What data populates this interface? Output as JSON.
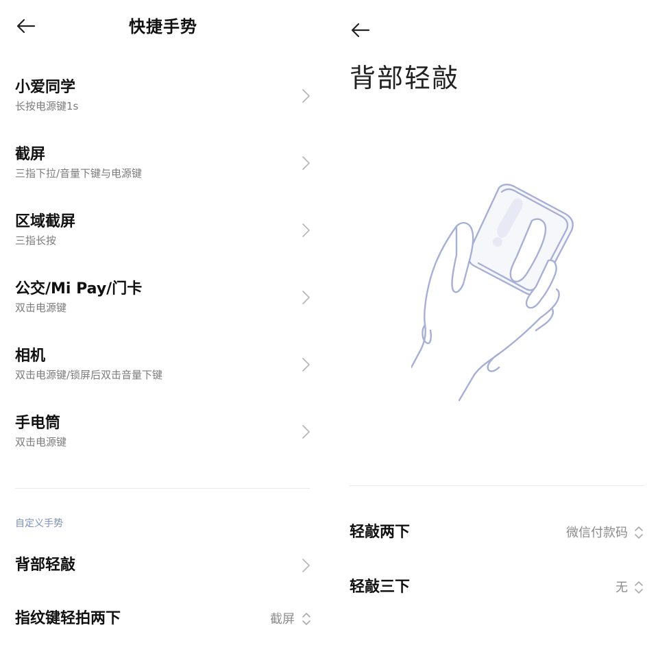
{
  "left": {
    "title": "快捷手势",
    "items": [
      {
        "title": "小爱同学",
        "subtitle": "长按电源键1s"
      },
      {
        "title": "截屏",
        "subtitle": "三指下拉/音量下键与电源键"
      },
      {
        "title": "区域截屏",
        "subtitle": "三指长按"
      },
      {
        "title": "公交/Mi Pay/门卡",
        "subtitle": "双击电源键"
      },
      {
        "title": "相机",
        "subtitle": "双击电源键/锁屏后双击音量下键"
      },
      {
        "title": "手电筒",
        "subtitle": "双击电源键"
      }
    ],
    "section_header": "自定义手势",
    "back_tap": {
      "label": "背部轻敲"
    },
    "fingerprint": {
      "label": "指纹键轻拍两下",
      "value": "截屏"
    }
  },
  "right": {
    "title": "背部轻敲",
    "double_tap": {
      "label": "轻敲两下",
      "value": "微信付款码"
    },
    "triple_tap": {
      "label": "轻敲三下",
      "value": "无"
    }
  },
  "icons": {
    "back": "back-arrow-icon",
    "chevron": "chevron-right-icon",
    "updown": "updown-arrows-icon"
  },
  "colors": {
    "section_header": "#7c8fc4",
    "illustration_stroke": "#a7afd6",
    "secondary_text": "#7b7b7b",
    "chevron": "#b8b8b8"
  }
}
